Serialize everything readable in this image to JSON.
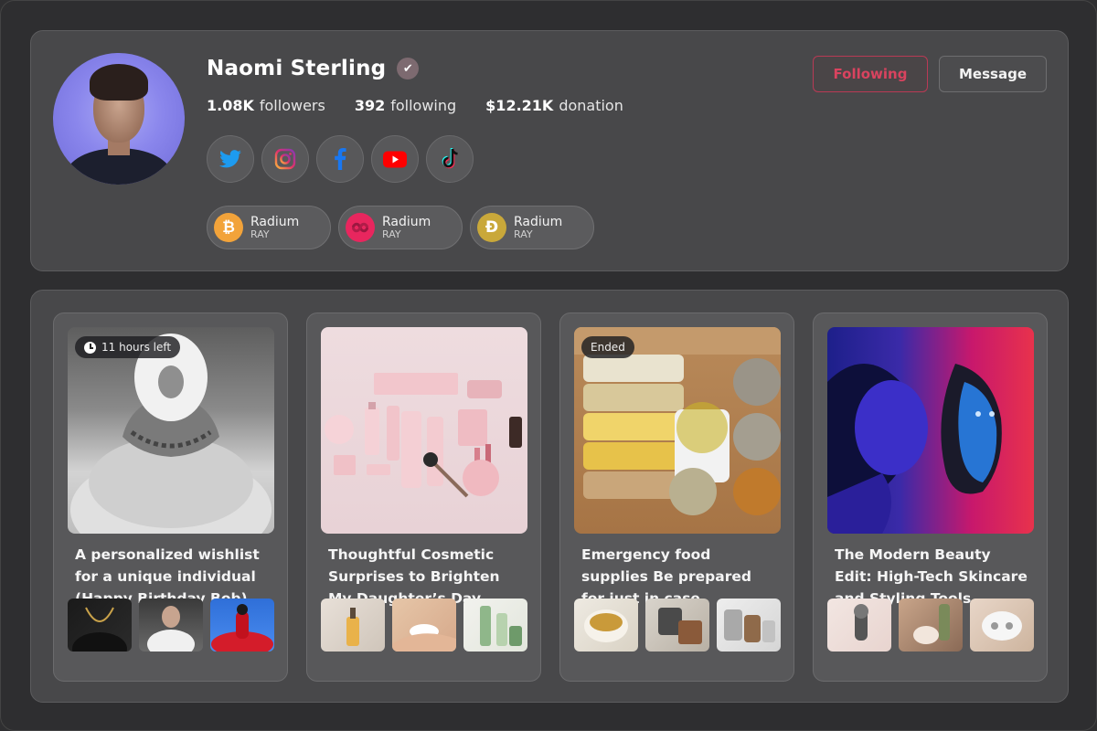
{
  "profile": {
    "name": "Naomi Sterling",
    "verified_icon": "check-badge-icon",
    "stats": [
      {
        "value": "1.08K",
        "label": "followers"
      },
      {
        "value": "392",
        "label": "following"
      },
      {
        "value": "$12.21K",
        "label": "donation"
      }
    ],
    "socials": [
      {
        "name": "twitter",
        "color": "#1d9bf0"
      },
      {
        "name": "instagram",
        "color": "#e1306c"
      },
      {
        "name": "facebook",
        "color": "#1877f2"
      },
      {
        "name": "youtube",
        "color": "#ff0000"
      },
      {
        "name": "tiktok",
        "color": "#ffffff"
      }
    ],
    "coins": [
      {
        "name": "Radium",
        "symbol": "RAY",
        "glyph": "₿",
        "color": "#f2a33a"
      },
      {
        "name": "Radium",
        "symbol": "RAY",
        "glyph": "",
        "color": "#e8265e"
      },
      {
        "name": "Radium",
        "symbol": "RAY",
        "glyph": "Ð",
        "color": "#c9a83a"
      }
    ],
    "following_label": "Following",
    "message_label": "Message",
    "accent_color": "#d9435f"
  },
  "wishlists": [
    {
      "title": "A personalized wishlist for a unique individual (Happy Birthday Bob)",
      "badge": "11 hours left"
    },
    {
      "title": "Thoughtful Cosmetic Surprises to Brighten My Daughter’s Day",
      "badge": ""
    },
    {
      "title": "Emergency food supplies Be prepared for just in case",
      "badge": "Ended"
    },
    {
      "title": "The Modern Beauty Edit: High-Tech Skincare and Styling Tools",
      "badge": ""
    }
  ]
}
